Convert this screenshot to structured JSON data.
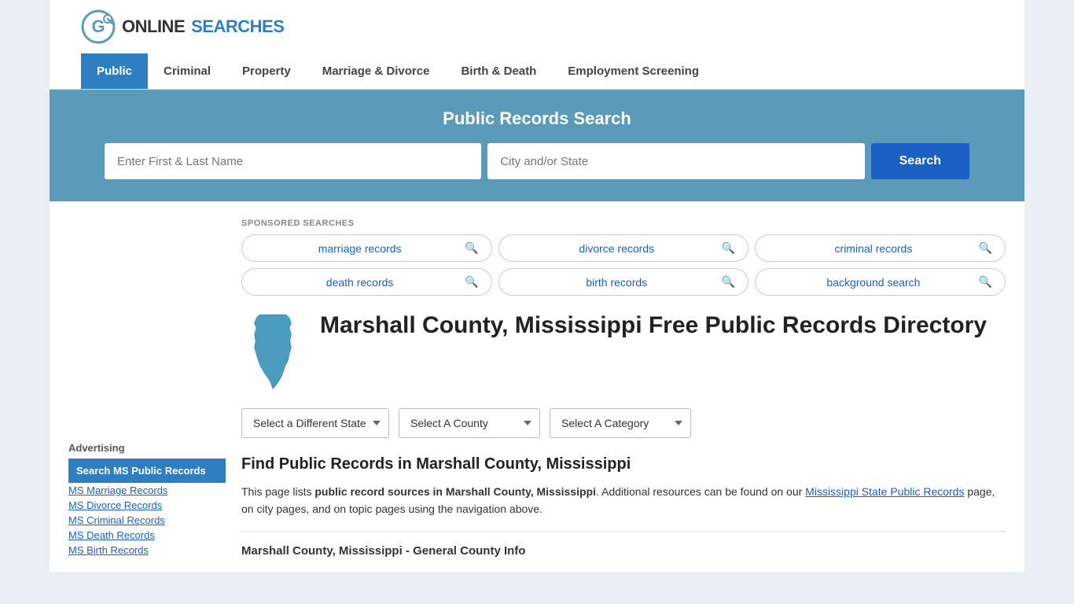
{
  "logo": {
    "text_online": "ONLINE",
    "text_searches": "SEARCHES",
    "icon_label": "online-searches-logo"
  },
  "nav": {
    "items": [
      {
        "label": "Public",
        "active": true
      },
      {
        "label": "Criminal",
        "active": false
      },
      {
        "label": "Property",
        "active": false
      },
      {
        "label": "Marriage & Divorce",
        "active": false
      },
      {
        "label": "Birth & Death",
        "active": false
      },
      {
        "label": "Employment Screening",
        "active": false
      }
    ]
  },
  "search_banner": {
    "title": "Public Records Search",
    "name_placeholder": "Enter First & Last Name",
    "location_placeholder": "City and/or State",
    "button_label": "Search"
  },
  "sponsored": {
    "label": "SPONSORED SEARCHES",
    "items": [
      {
        "text": "marriage records"
      },
      {
        "text": "divorce records"
      },
      {
        "text": "criminal records"
      },
      {
        "text": "death records"
      },
      {
        "text": "birth records"
      },
      {
        "text": "background search"
      }
    ]
  },
  "page": {
    "title": "Marshall County, Mississippi Free Public Records Directory",
    "dropdowns": {
      "state_label": "Select a Different State",
      "county_label": "Select A County",
      "category_label": "Select A Category"
    },
    "find_title": "Find Public Records in Marshall County, Mississippi",
    "find_text_1": "This page lists ",
    "find_text_bold": "public record sources in Marshall County, Mississippi",
    "find_text_2": ". Additional resources can be found on our ",
    "find_link_text": "Mississippi State Public Records",
    "find_text_3": " page, on city pages, and on topic pages using the navigation above.",
    "county_info_heading": "Marshall County, Mississippi - General County Info"
  },
  "sidebar": {
    "advertising_label": "Advertising",
    "ad_item": "Search MS Public Records",
    "links": [
      "MS Marriage Records",
      "MS Divorce Records",
      "MS Criminal Records",
      "MS Death Records",
      "MS Birth Records"
    ]
  },
  "colors": {
    "primary_blue": "#2d7fc1",
    "dark_blue": "#1a5fc4",
    "banner_blue": "#5b9ab8"
  }
}
